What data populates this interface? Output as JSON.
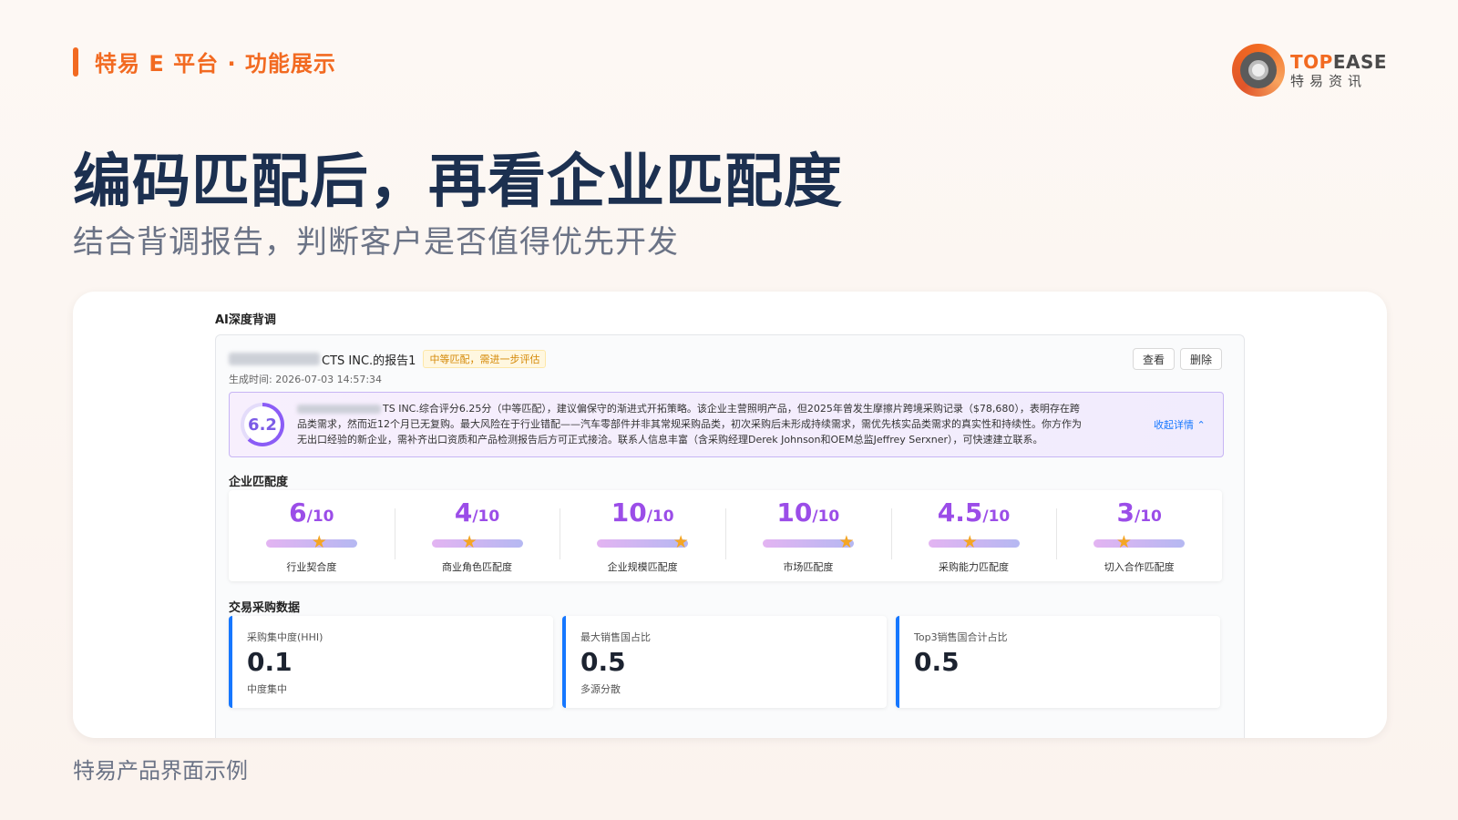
{
  "slide": {
    "label": "特易 E 平台 · 功能展示",
    "title": "编码匹配后，再看企业匹配度",
    "subtitle": "结合背调报告，判断客户是否值得优先开发",
    "caption": "特易产品界面示例"
  },
  "logo": {
    "en_top": "TOP",
    "en_ease": "EASE",
    "cn": "特易资讯"
  },
  "colors": {
    "accent": "#f26a21",
    "title": "#1c3050",
    "score_purple": "#9b4de8",
    "link_blue": "#1677ff"
  },
  "app": {
    "section_title": "AI深度背调",
    "report": {
      "name_suffix": "CTS INC.的报告1",
      "tag": "中等匹配，需进一步评估",
      "generated_time": "生成时间: 2026-07-03 14:57:34",
      "view_label": "查看",
      "delete_label": "删除",
      "score": "6.2",
      "score_fraction": 0.62,
      "summary_line1": "TS INC.综合评分6.25分（中等匹配），建议偏保守的渐进式开拓策略。该企业主营照明产品，但2025年曾发生摩擦片跨境采购记录（$78,680），表明存在跨",
      "summary_line2": "品类需求，然而近12个月已无复购。最大风险在于行业错配——汽车零部件并非其常规采购品类，初次采购后未形成持续需求，需优先核实品类需求的真实性和持续性。你方作为",
      "summary_line3": "无出口经验的新企业，需补齐出口资质和产品检测报告后方可正式接洽。联系人信息丰富（含采购经理Derek Johnson和OEM总监Jeffrey Serxner），可快速建立联系。",
      "collapse_label": "收起详情 ⌃"
    },
    "match": {
      "title": "企业匹配度",
      "items": [
        {
          "score": "6",
          "max": "/10",
          "value": 6,
          "label": "行业契合度"
        },
        {
          "score": "4",
          "max": "/10",
          "value": 4,
          "label": "商业角色匹配度"
        },
        {
          "score": "10",
          "max": "/10",
          "value": 10,
          "label": "企业规模匹配度"
        },
        {
          "score": "10",
          "max": "/10",
          "value": 10,
          "label": "市场匹配度"
        },
        {
          "score": "4.5",
          "max": "/10",
          "value": 4.5,
          "label": "采购能力匹配度"
        },
        {
          "score": "3",
          "max": "/10",
          "value": 3,
          "label": "切入合作匹配度"
        }
      ]
    },
    "trade": {
      "title": "交易采购数据",
      "cards": [
        {
          "label": "采购集中度(HHI)",
          "value": "0.1",
          "desc": "中度集中"
        },
        {
          "label": "最大销售国占比",
          "value": "0.5",
          "desc": "多源分散"
        },
        {
          "label": "Top3销售国合计占比",
          "value": "0.5",
          "desc": ""
        }
      ]
    }
  }
}
